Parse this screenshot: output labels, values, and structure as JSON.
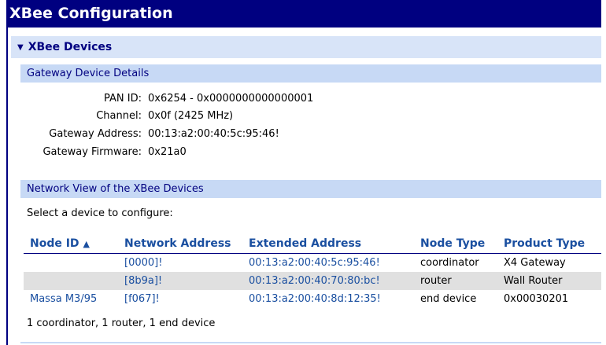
{
  "window": {
    "title": "XBee Configuration"
  },
  "section": {
    "label": "XBee Devices",
    "expanded_icon": "triangle-down-icon"
  },
  "gateway": {
    "header": "Gateway Device Details",
    "fields": [
      {
        "label": "PAN ID:",
        "value": "0x6254 - 0x0000000000000001"
      },
      {
        "label": "Channel:",
        "value": "0x0f (2425 MHz)"
      },
      {
        "label": "Gateway Address:",
        "value": "00:13:a2:00:40:5c:95:46!"
      },
      {
        "label": "Gateway Firmware:",
        "value": "0x21a0"
      }
    ]
  },
  "network": {
    "header": "Network View of the XBee Devices",
    "prompt": "Select a device to configure:",
    "columns": {
      "node_id": "Node ID",
      "sort_indicator": "▲",
      "network_address": "Network Address",
      "extended_address": "Extended Address",
      "node_type": "Node Type",
      "product_type": "Product Type"
    },
    "rows": [
      {
        "node_id": "",
        "network_address": "[0000]!",
        "extended_address": "00:13:a2:00:40:5c:95:46!",
        "node_type": "coordinator",
        "product_type": "X4 Gateway"
      },
      {
        "node_id": "",
        "network_address": "[8b9a]!",
        "extended_address": "00:13:a2:00:40:70:80:bc!",
        "node_type": "router",
        "product_type": "Wall Router"
      },
      {
        "node_id": "Massa M3/95",
        "network_address": "[f067]!",
        "extended_address": "00:13:a2:00:40:8d:12:35!",
        "node_type": "end device",
        "product_type": "0x00030201"
      }
    ],
    "summary": "1 coordinator, 1 router, 1 end device"
  },
  "colors": {
    "title_bg": "#000080",
    "section_bg": "#d8e4f8",
    "subheader_bg": "#c7d9f5",
    "link": "#1a4fa0",
    "alt_row": "#e0e0e0"
  }
}
